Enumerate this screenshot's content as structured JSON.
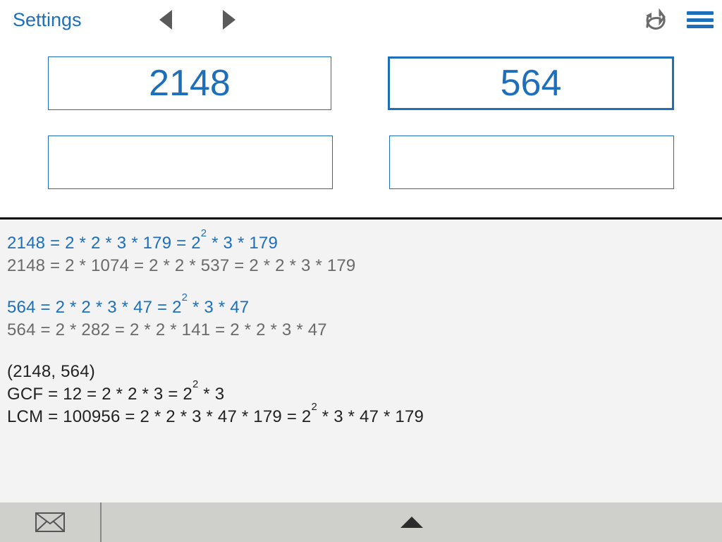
{
  "topbar": {
    "settings_label": "Settings"
  },
  "inputs": {
    "a": "2148",
    "b": "564",
    "c": "",
    "d": ""
  },
  "results": {
    "block1": {
      "prime_html": "2148 = 2  *  2  *  3  *  179 = 2<sup>2</sup>  *  3  *  179",
      "steps": "2148 = 2 * 1074 = 2 * 2 * 537 = 2 * 2 * 3 * 179"
    },
    "block2": {
      "prime_html": "564 = 2  *  2  *  3  *  47 = 2<sup>2</sup>  *  3  *  47",
      "steps": "564 = 2 * 282 = 2 * 2 * 141 = 2 * 2 * 3 * 47"
    },
    "pair_label": "(2148, 564)",
    "gcf_html": "GCF = 12 = 2 * 2 * 3 = 2<sup>2</sup> * 3",
    "lcm_html": "LCM = 100956 = 2 * 2 * 3 * 47 * 179 = 2<sup>2</sup> * 3 * 47 * 179"
  },
  "colors": {
    "accent": "#1d6fbb"
  }
}
